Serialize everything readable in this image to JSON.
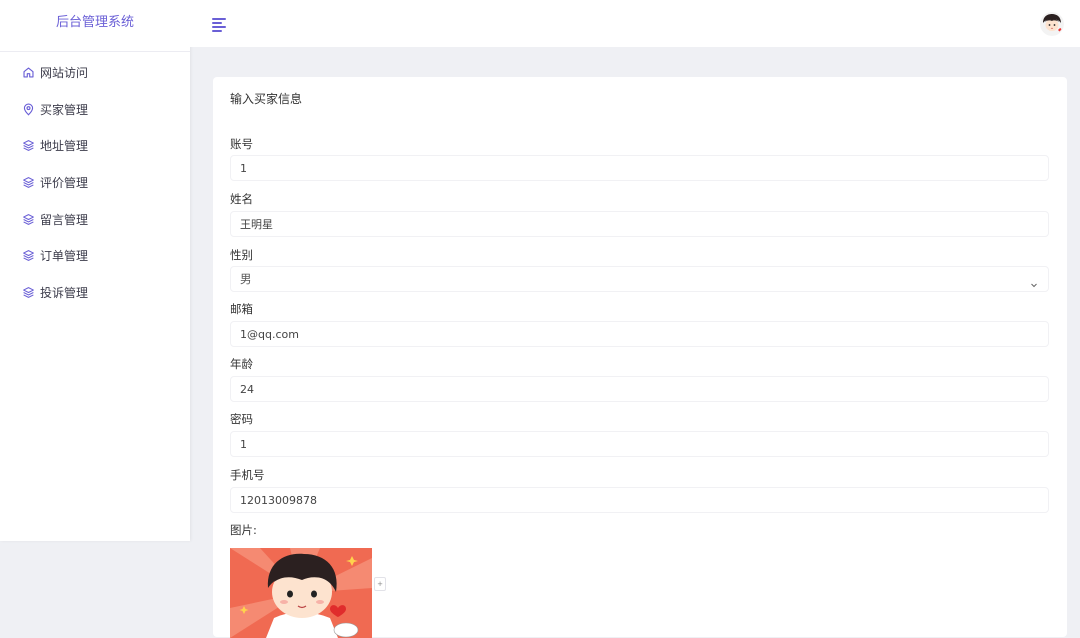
{
  "app": {
    "title": "后台管理系统"
  },
  "sidebar": {
    "items": [
      {
        "label": "网站访问",
        "icon": "home-icon"
      },
      {
        "label": "买家管理",
        "icon": "location-pin-icon"
      },
      {
        "label": "地址管理",
        "icon": "layers-icon"
      },
      {
        "label": "评价管理",
        "icon": "layers-icon"
      },
      {
        "label": "留言管理",
        "icon": "layers-icon"
      },
      {
        "label": "订单管理",
        "icon": "layers-icon"
      },
      {
        "label": "投诉管理",
        "icon": "layers-icon"
      }
    ]
  },
  "header": {
    "menu_icon": "hamburger-icon",
    "avatar": "user-avatar"
  },
  "form": {
    "title": "输入买家信息",
    "account": {
      "label": "账号",
      "value": "1"
    },
    "name": {
      "label": "姓名",
      "value": "王明星"
    },
    "gender": {
      "label": "性别",
      "value": "男"
    },
    "email": {
      "label": "邮箱",
      "value": "1@qq.com"
    },
    "age": {
      "label": "年龄",
      "value": "24"
    },
    "password": {
      "label": "密码",
      "value": "1"
    },
    "phone": {
      "label": "手机号",
      "value": "12013009878"
    },
    "image": {
      "label": "图片:",
      "button": "+"
    }
  },
  "colors": {
    "accent": "#6a5fd6",
    "background": "#eff0f4",
    "card": "#ffffff"
  }
}
